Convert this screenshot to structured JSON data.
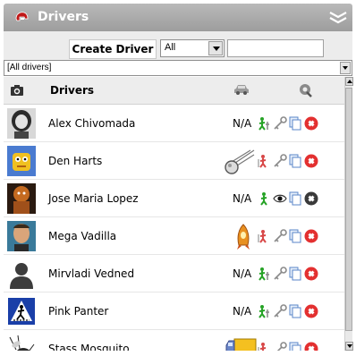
{
  "panel": {
    "title": "Drivers",
    "title_icon": "helmet-icon",
    "collapse_icon": "double-chevron-down-icon"
  },
  "toolbar": {
    "create_label": "Create Driver",
    "filter_value": "All",
    "search_value": "",
    "search_placeholder": ""
  },
  "group_select": {
    "value": "[All drivers]"
  },
  "table": {
    "header_label": "Drivers",
    "columns": [
      "photo",
      "name",
      "vehicle",
      "actions"
    ]
  },
  "colors": {
    "title_bar": "#a8a8a8",
    "toolbar_bg": "#ececec",
    "header_bg": "#ededed",
    "delete_red": "#e33030",
    "person_green": "#26a326"
  },
  "drivers": [
    {
      "name": "Alex Chivomada",
      "vehicle": "N/A",
      "avatar": "portrait-photo",
      "status": "active"
    },
    {
      "name": "Den Harts",
      "vehicle": "",
      "vehicle_icon": "comet-icon",
      "avatar": "robot-photo",
      "status": "inactive"
    },
    {
      "name": "Jose Maria Lopez",
      "vehicle": "N/A",
      "avatar": "character-photo",
      "status": "active",
      "locked": true
    },
    {
      "name": "Mega Vadilla",
      "vehicle": "",
      "vehicle_icon": "rocket-icon",
      "avatar": "man-photo",
      "status": "inactive"
    },
    {
      "name": "Mirvladi Vedned",
      "vehicle": "N/A",
      "avatar": "silhouette-icon",
      "status": "active"
    },
    {
      "name": "Pink Panter",
      "vehicle": "N/A",
      "avatar": "pedestrian-sign",
      "status": "active"
    },
    {
      "name": "Stass Mosquito",
      "vehicle": "",
      "vehicle_icon": "truck-icon",
      "avatar": "mosquito-photo",
      "status": "inactive"
    }
  ]
}
